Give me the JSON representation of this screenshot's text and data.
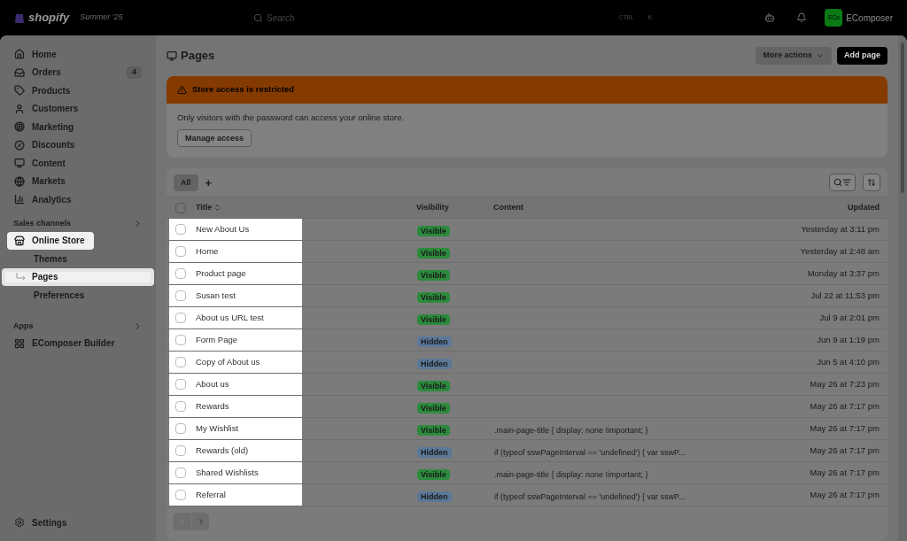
{
  "topbar": {
    "brand": "shopify",
    "edition": "Summer '25",
    "search": {
      "placeholder": "Search"
    },
    "shortcut": [
      "CTRL",
      "K"
    ],
    "avatar": "ECo",
    "store": "EComposer"
  },
  "sidebar": {
    "items": [
      {
        "label": "Home",
        "highlighted": false
      },
      {
        "label": "Orders",
        "badge": "4",
        "highlighted": false
      },
      {
        "label": "Products",
        "highlighted": false
      },
      {
        "label": "Customers",
        "highlighted": false
      },
      {
        "label": "Marketing",
        "highlighted": false
      },
      {
        "label": "Discounts",
        "highlighted": false
      },
      {
        "label": "Content",
        "highlighted": false
      },
      {
        "label": "Markets",
        "highlighted": false
      },
      {
        "label": "Analytics",
        "highlighted": false
      }
    ],
    "sales_channels": {
      "title": "Sales channels",
      "items": [
        {
          "label": "Online Store",
          "highlighted": true,
          "children": [
            {
              "label": "Themes",
              "selected": false
            },
            {
              "label": "Pages",
              "selected": true
            },
            {
              "label": "Preferences",
              "selected": false
            }
          ]
        }
      ]
    },
    "apps": {
      "title": "Apps",
      "items": [
        {
          "label": "EComposer Builder",
          "highlighted": false
        }
      ]
    },
    "settings": "Settings"
  },
  "page": {
    "title": "Pages",
    "actions": [
      {
        "label": "More actions",
        "kind": "menu"
      },
      {
        "label": "Add page",
        "kind": "primary"
      }
    ],
    "banner": {
      "title": "Store access is restricted",
      "text": "Only visitors with the password can access your online store.",
      "button": "Manage access"
    },
    "table": {
      "tabs": [
        {
          "label": "All",
          "selected": true
        }
      ],
      "add_tab": "+",
      "columns": [
        "Title",
        "Visibility",
        "Content",
        "Updated"
      ],
      "all_checked": false,
      "rows": [
        {
          "title": "New About Us",
          "visibility": "Visible",
          "visible": true,
          "updated": "Yesterday at 3:11 pm",
          "checked": false,
          "highlighted": true
        },
        {
          "title": "Home",
          "visibility": "Visible",
          "visible": true,
          "updated": "Yesterday at 2:48 am",
          "checked": false,
          "highlighted": true
        },
        {
          "title": "Product page",
          "visibility": "Visible",
          "visible": true,
          "updated": "Monday at 3:37 pm",
          "checked": false,
          "highlighted": true
        },
        {
          "title": "Susan test",
          "visibility": "Visible",
          "visible": true,
          "updated": "Jul 22 at 11:53 pm",
          "checked": false,
          "highlighted": true
        },
        {
          "title": "About us URL test",
          "visibility": "Visible",
          "visible": true,
          "updated": "Jul 9 at 2:01 pm",
          "checked": false,
          "highlighted": true
        },
        {
          "title": "Form Page",
          "visibility": "Hidden",
          "visible": false,
          "updated": "Jun 9 at 1:19 pm",
          "checked": false,
          "highlighted": true
        },
        {
          "title": "Copy of About us",
          "visibility": "Hidden",
          "visible": false,
          "updated": "Jun 5 at 4:10 pm",
          "checked": false,
          "highlighted": true
        },
        {
          "title": "About us",
          "visibility": "Visible",
          "visible": true,
          "updated": "May 26 at 7:23 pm",
          "checked": false,
          "highlighted": true
        },
        {
          "title": "Rewards",
          "visibility": "Visible",
          "visible": true,
          "updated": "May 26 at 7:17 pm",
          "checked": false,
          "highlighted": true
        },
        {
          "title": "My Wishlist",
          "visibility": "Visible",
          "visible": true,
          "content": ".main-page-title { display: none !important; }",
          "updated": "May 26 at 7:17 pm",
          "checked": false,
          "highlighted": true
        },
        {
          "title": "Rewards (old)",
          "visibility": "Hidden",
          "visible": false,
          "content": "if (typeof sswPageInterval == 'undefined') { var sswP...",
          "updated": "May 26 at 7:17 pm",
          "checked": false,
          "highlighted": true
        },
        {
          "title": "Shared Wishlists",
          "visibility": "Visible",
          "visible": true,
          "content": ".main-page-title { display: none !important; }",
          "updated": "May 26 at 7:17 pm",
          "checked": false,
          "highlighted": true
        },
        {
          "title": "Referral",
          "visibility": "Hidden",
          "visible": false,
          "content": "if (typeof sswPageInterval == 'undefined') { var sswP...",
          "updated": "May 26 at 7:17 pm",
          "checked": false,
          "highlighted": true
        }
      ],
      "pagination": {
        "previous": {
          "disabled": true
        },
        "next": {
          "disabled": false
        }
      }
    }
  }
}
